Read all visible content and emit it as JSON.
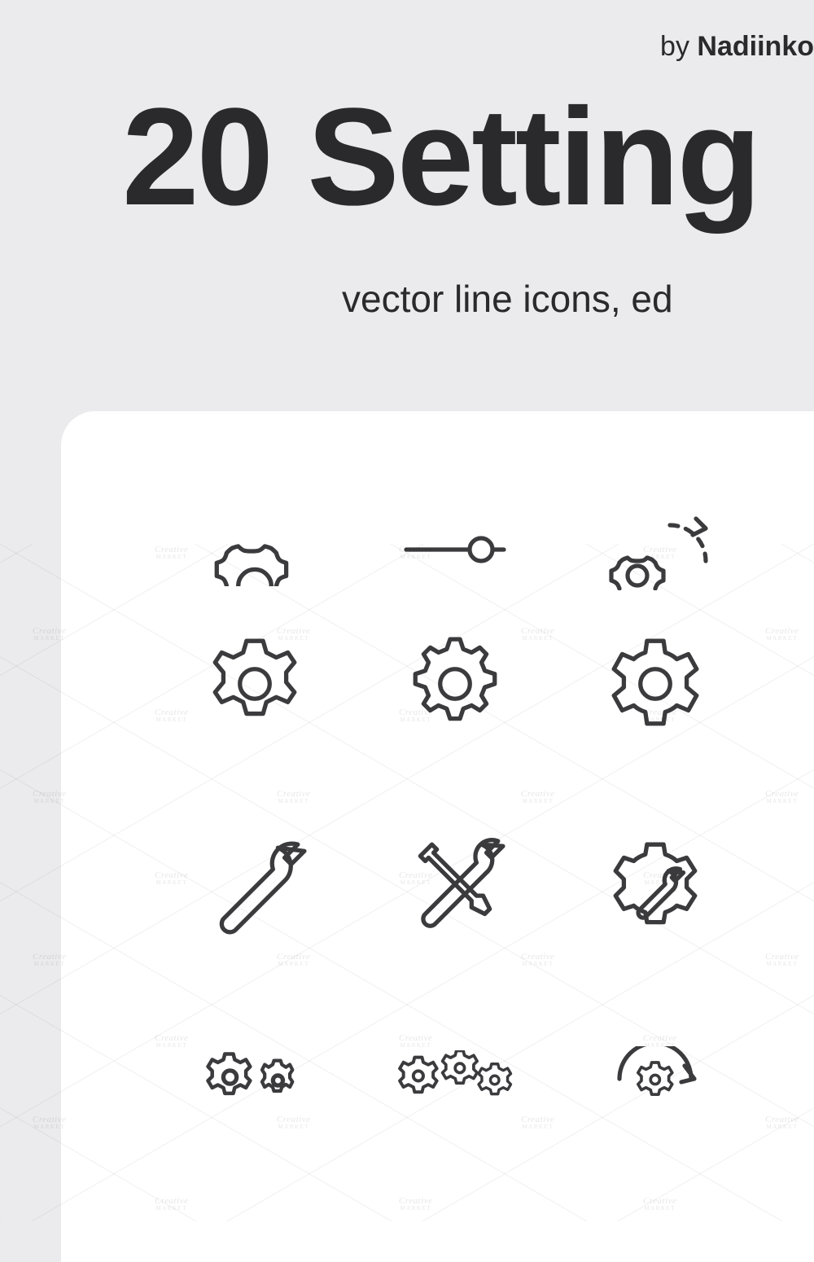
{
  "byline": {
    "prefix": "by",
    "author": "Nadiinko"
  },
  "title": "20 Setting",
  "subtitle": "vector line icons, ed",
  "watermark": {
    "brand": "Creative",
    "sub": "MARKET"
  },
  "icons": {
    "row1": [
      {
        "name": "gear-half-icon"
      },
      {
        "name": "slider-control-icon"
      },
      {
        "name": "gear-refresh-icon"
      }
    ],
    "row2": [
      {
        "name": "gear-basic-icon"
      },
      {
        "name": "gear-detailed-icon"
      },
      {
        "name": "gear-rounded-icon"
      }
    ],
    "row3": [
      {
        "name": "wrench-icon"
      },
      {
        "name": "tools-cross-icon"
      },
      {
        "name": "gear-wrench-icon"
      }
    ],
    "row4": [
      {
        "name": "gears-pair-icon"
      },
      {
        "name": "gears-triple-icon"
      },
      {
        "name": "gear-sync-icon"
      }
    ]
  }
}
